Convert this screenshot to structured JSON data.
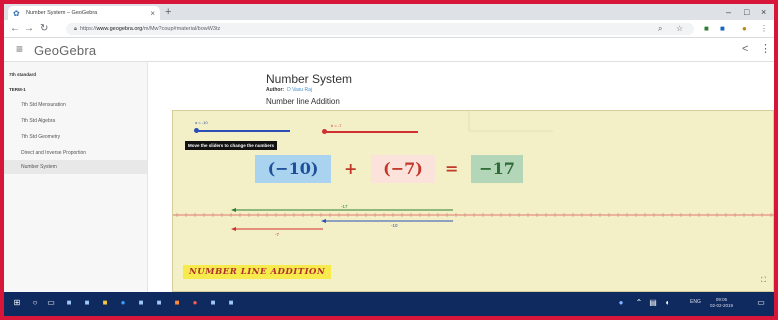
{
  "browser": {
    "tab_title": "Number System – GeoGebra",
    "url_scheme": "https://",
    "url_domain": "www.geogebra.org",
    "url_path": "/m/Mw?coup#material/bowW3tz"
  },
  "header": {
    "logo": "GeoGebra"
  },
  "sidebar": {
    "standard": "7th standard",
    "term": "TERM-1",
    "items": [
      {
        "label": "7th Std Mensuration"
      },
      {
        "label": "7th Std Algebra"
      },
      {
        "label": "7th Std Geometry"
      },
      {
        "label": "Direct and Inverse Proportion"
      },
      {
        "label": "Number System"
      }
    ]
  },
  "material": {
    "title": "Number System",
    "author_label": "Author:",
    "author_name": "D Vasu Raj",
    "subtitle": "Number line Addition"
  },
  "applet": {
    "slider_a_label": "a = -10",
    "slider_b_label": "b = -7",
    "instruction": "Move the sliders to change the numbers",
    "term_a": "(−10)",
    "plus": "+",
    "term_b": "(−7)",
    "equals": "=",
    "result": "−17",
    "arrow_result_label": "-17",
    "arrow_a_label": "-10",
    "arrow_b_label": "-7",
    "banner": "NUMBER LINE ADDITION",
    "colors": {
      "background": "#f3efc6",
      "term_a_box": "#a9d3ee",
      "term_b_box": "#fbe3dc",
      "result_box": "#b3d6b8",
      "negative_text": "#c0392b",
      "result_text": "#2e6b35",
      "axis": "#e07a70"
    }
  },
  "taskbar": {
    "tray_lang": "ENG",
    "clock_time": "09:06",
    "clock_date": "02-02-2019"
  }
}
